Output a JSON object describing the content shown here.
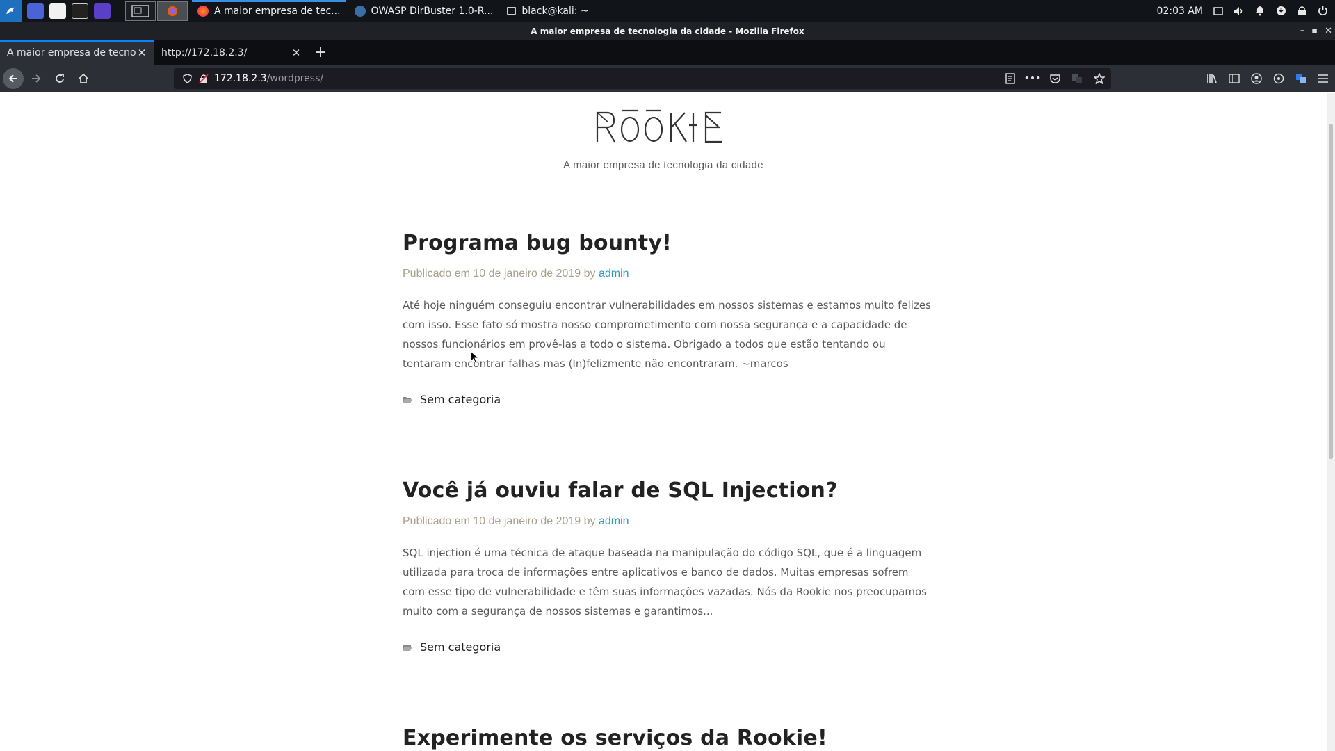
{
  "taskbar": {
    "tasks": [
      {
        "label": "A maior empresa de tec..."
      },
      {
        "label": "OWASP DirBuster 1.0-R..."
      },
      {
        "label": "black@kali: ~"
      }
    ],
    "clock": "02:03 AM"
  },
  "window": {
    "title": "A maior empresa de tecnologia da cidade - Mozilla Firefox"
  },
  "tabs": [
    {
      "label": "A maior empresa de tecnolo"
    },
    {
      "label": "http://172.18.2.3/"
    }
  ],
  "urlbar": {
    "host": "172.18.2.3",
    "path": "/wordpress/"
  },
  "site": {
    "logo_text": "RŌŌKIE",
    "tagline": "A maior empresa de tecnologia da cidade"
  },
  "posts": [
    {
      "title": "Programa bug bounty!",
      "meta_prefix": "Publicado em 10 de janeiro de 2019 by",
      "author": "admin",
      "excerpt": "Até hoje ninguém conseguiu encontrar vulnerabilidades em nossos sistemas e estamos muito felizes com isso. Esse fato só mostra nosso comprometimento com nossa segurança e a capacidade de nossos funcionários em provê-las a todo o sistema. Obrigado a todos que estão tentando ou tentaram encontrar falhas mas (In)felizmente não encontraram. ~marcos",
      "category": "Sem categoria"
    },
    {
      "title": "Você já ouviu falar de SQL Injection?",
      "meta_prefix": "Publicado em 10 de janeiro de 2019 by",
      "author": "admin",
      "excerpt": "SQL injection é uma técnica de ataque baseada na manipulação do código SQL, que é a linguagem utilizada para troca de informações entre aplicativos e banco de dados. Muitas empresas sofrem com esse tipo de vulnerabilidade e têm suas informações vazadas. Nós da Rookie nos preocupamos muito com a segurança de nossos sistemas e garantimos...",
      "category": "Sem categoria"
    },
    {
      "title": "Experimente os serviços da Rookie!"
    }
  ],
  "colors": {
    "taskbar_bg": "#111418",
    "toolbar_bg": "#2c2f36",
    "accent_blue": "#0a84ff",
    "meta_text": "#a9a08e",
    "author_link": "#2a9fb8"
  }
}
